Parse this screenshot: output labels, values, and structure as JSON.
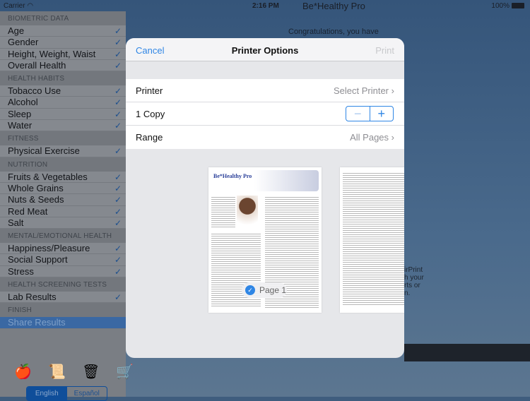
{
  "status": {
    "carrier": "Carrier",
    "time": "2:16 PM",
    "app_title": "Be*Healthy Pro",
    "battery": "100%"
  },
  "sidebar": {
    "sections": [
      {
        "header": "BIOMETRIC DATA",
        "items": [
          "Age",
          "Gender",
          "Height, Weight, Waist",
          "Overall Health"
        ]
      },
      {
        "header": "HEALTH HABITS",
        "items": [
          "Tobacco Use",
          "Alcohol",
          "Sleep",
          "Water"
        ]
      },
      {
        "header": "FITNESS",
        "items": [
          "Physical Exercise"
        ]
      },
      {
        "header": "NUTRITION",
        "items": [
          "Fruits & Vegetables",
          "Whole Grains",
          "Nuts & Seeds",
          "Red Meat",
          "Salt"
        ]
      },
      {
        "header": "MENTAL/EMOTIONAL HEALTH",
        "items": [
          "Happiness/Pleasure",
          "Social Support",
          "Stress"
        ]
      },
      {
        "header": "HEALTH SCREENING TESTS",
        "items": [
          "Lab Results"
        ]
      },
      {
        "header": "FINISH",
        "items": [
          "Share Results"
        ]
      }
    ],
    "selected": "Share Results",
    "checkmark": "✓",
    "icons": [
      "apple-measure-icon",
      "scroll-icon",
      "recycle-bin-icon",
      "shopping-cart-icon"
    ],
    "languages": {
      "english": "English",
      "spanish": "Español",
      "selected": "English"
    }
  },
  "background": {
    "congrats": "Congratulations, you have",
    "airprint": [
      "irPrint",
      "h your",
      "rts or",
      "n."
    ]
  },
  "modal": {
    "cancel": "Cancel",
    "title": "Printer Options",
    "print": "Print",
    "printer_label": "Printer",
    "printer_value": "Select Printer",
    "copies_label": "1 Copy",
    "minus": "−",
    "plus": "+",
    "range_label": "Range",
    "range_value": "All Pages",
    "preview": {
      "page_badge": "Page 1",
      "doc_title": "Be*Healthy Pro",
      "selected": true
    }
  },
  "colors": {
    "accent": "#2f86e5",
    "sidebar_selected": "#3a68a3"
  }
}
